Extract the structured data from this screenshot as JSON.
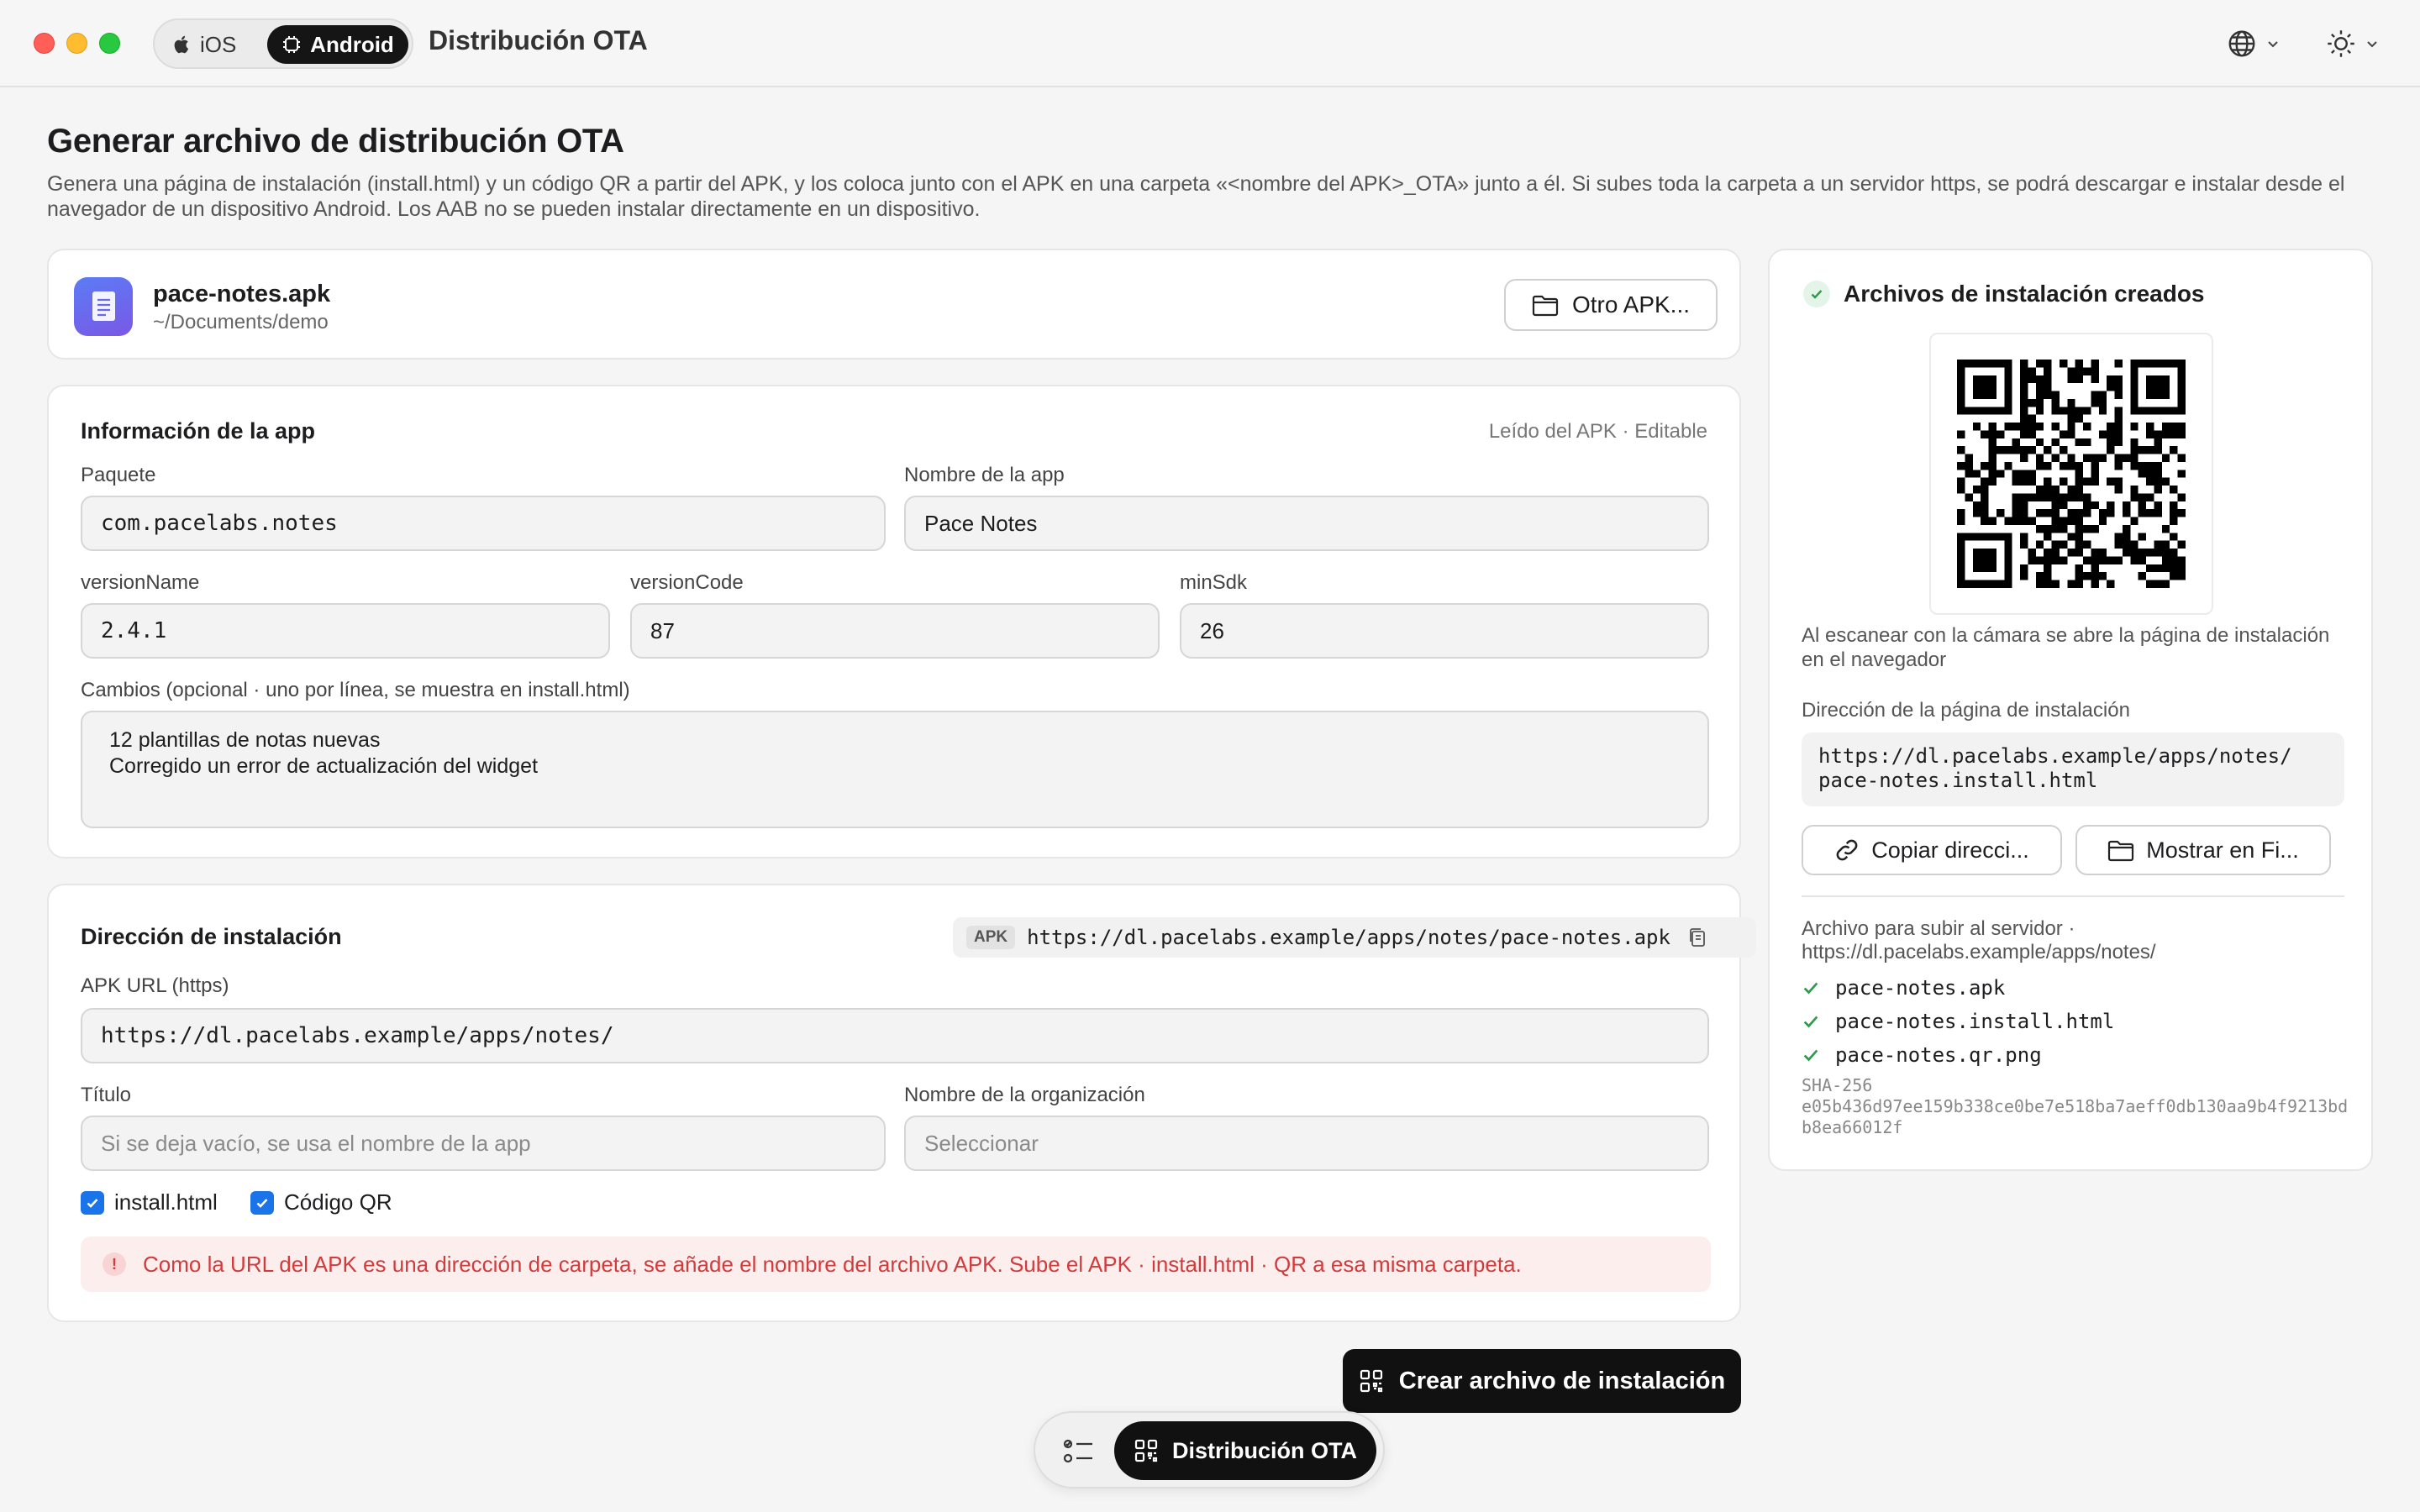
{
  "titlebar": {
    "platform_ios": "iOS",
    "platform_android": "Android",
    "app_title": "Distribución OTA"
  },
  "page": {
    "title": "Generar archivo de distribución OTA",
    "description": "Genera una página de instalación (install.html) y un código QR a partir del APK, y los coloca junto con el APK en una carpeta «<nombre del APK>_OTA» junto a él. Si subes toda la carpeta a un servidor https, se podrá descargar e instalar desde el navegador de un dispositivo Android. Los AAB no se pueden instalar directamente en un dispositivo."
  },
  "file": {
    "name": "pace-notes.apk",
    "path": "~/Documents/demo",
    "other_button": "Otro APK..."
  },
  "info": {
    "title": "Información de la app",
    "hint": "Leído del APK · Editable",
    "package_label": "Paquete",
    "package_value": "com.pacelabs.notes",
    "appname_label": "Nombre de la app",
    "appname_value": "Pace Notes",
    "versionname_label": "versionName",
    "versionname_value": "2.4.1",
    "versioncode_label": "versionCode",
    "versioncode_value": "87",
    "minsdk_label": "minSdk",
    "minsdk_value": "26",
    "changes_label": "Cambios (opcional · uno por línea, se muestra en install.html)",
    "changes_value": "12 plantillas de notas nuevas\nCorregido un error de actualización del widget"
  },
  "address": {
    "title": "Dirección de instalación",
    "apk_tag": "APK",
    "apk_full_url": "https://dl.pacelabs.example/apps/notes/pace-notes.apk",
    "apk_url_label": "APK URL (https)",
    "apk_url_value": "https://dl.pacelabs.example/apps/notes/",
    "title_label": "Título",
    "title_placeholder": "Si se deja vacío, se usa el nombre de la app",
    "org_label": "Nombre de la organización",
    "org_placeholder": "Seleccionar",
    "check_install": "install.html",
    "check_qr": "Código QR",
    "warning": "Como la URL del APK es una dirección de carpeta, se añade el nombre del archivo APK. Sube el APK · install.html · QR a esa misma carpeta."
  },
  "actions": {
    "create": "Crear archivo de instalación"
  },
  "dock": {
    "active_label": "Distribución OTA"
  },
  "result": {
    "title": "Archivos de instalación creados",
    "qr_caption": "Al escanear con la cámara se abre la página de instalación en el navegador",
    "url_label": "Dirección de la página de instalación",
    "url_line1": "https://dl.pacelabs.example/apps/notes/",
    "url_line2": "pace-notes.install.html",
    "copy_button": "Copiar direcci...",
    "show_button": "Mostrar en Fi...",
    "upload_label": "Archivo para subir al servidor · https://dl.pacelabs.example/apps/notes/",
    "files": [
      "pace-notes.apk",
      "pace-notes.install.html",
      "pace-notes.qr.png"
    ],
    "sha_label": "SHA-256",
    "sha_value": "e05b436d97ee159b338ce0be7e518ba7aeff0db130aa9b4f9213bdb8ea66012f"
  },
  "colors": {
    "accent": "#1a73e8",
    "success": "#2e9a4a",
    "error": "#d23b3b",
    "dark": "#111111"
  }
}
